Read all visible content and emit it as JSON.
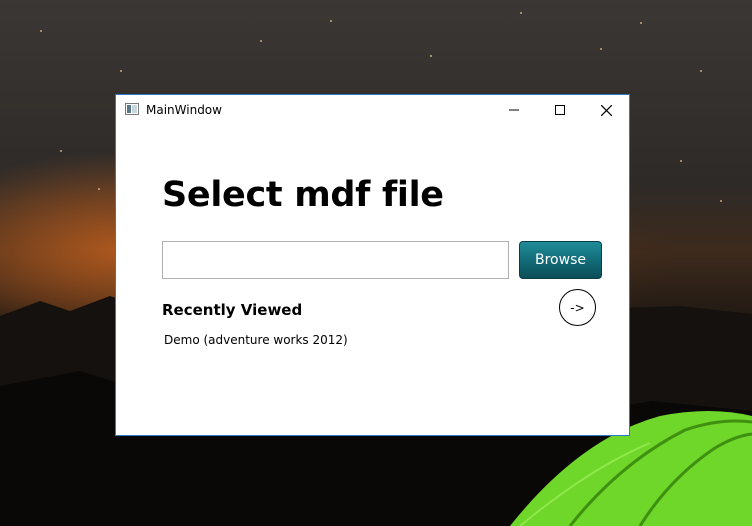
{
  "window": {
    "title": "MainWindow",
    "icon": "app-window-icon",
    "controls": [
      "minimize-icon",
      "maximize-icon",
      "close-icon"
    ]
  },
  "main": {
    "heading": "Select mdf file",
    "file_path_value": "",
    "file_path_placeholder": "",
    "browse_label": "Browse",
    "recent_heading": "Recently Viewed",
    "go_label": "->",
    "recent_items": [
      "Demo (adventure works 2012)"
    ]
  },
  "colors": {
    "browse_button": "#13707c",
    "window_border": "#2b79c7"
  }
}
